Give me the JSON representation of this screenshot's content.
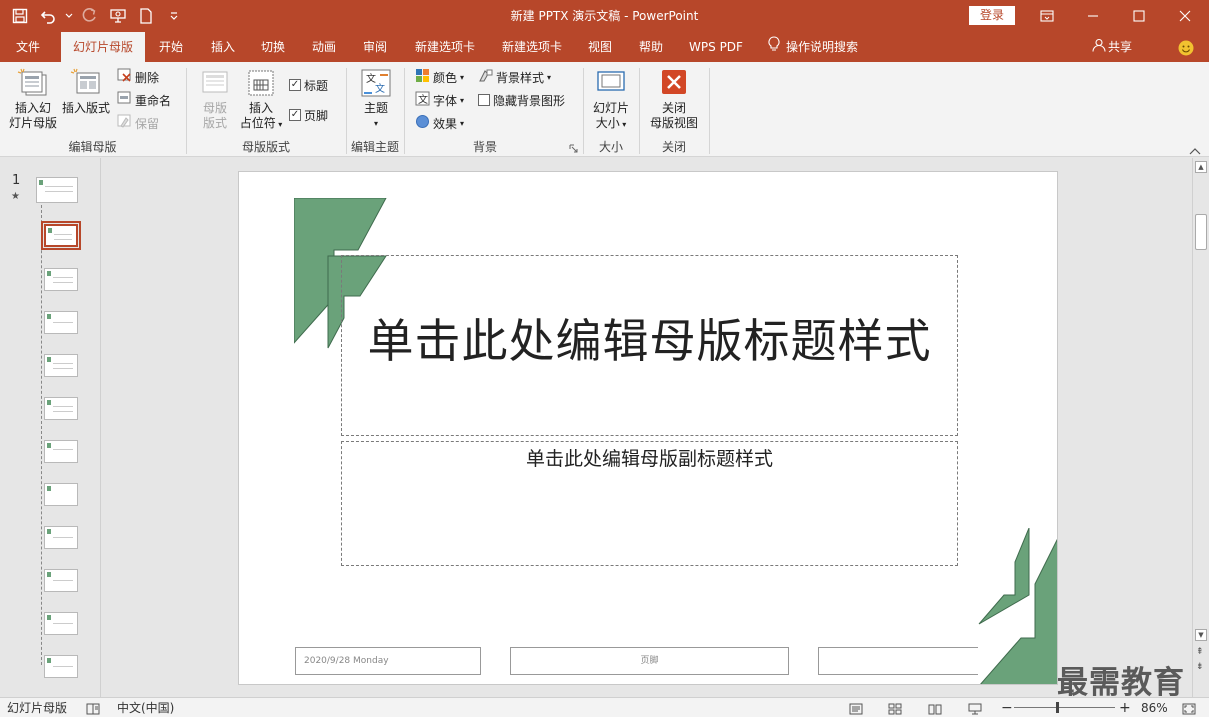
{
  "window": {
    "title": "新建 PPTX 演示文稿  -  PowerPoint",
    "login_label": "登录"
  },
  "tabs": [
    {
      "label": "文件"
    },
    {
      "label": "幻灯片母版"
    },
    {
      "label": "开始"
    },
    {
      "label": "插入"
    },
    {
      "label": "切换"
    },
    {
      "label": "动画"
    },
    {
      "label": "审阅"
    },
    {
      "label": "新建选项卡"
    },
    {
      "label": "新建选项卡"
    },
    {
      "label": "视图"
    },
    {
      "label": "帮助"
    },
    {
      "label": "WPS PDF"
    },
    {
      "label": "操作说明搜索"
    }
  ],
  "share_label": "共享",
  "ribbon": {
    "edit_master": {
      "label": "编辑母版",
      "insert_master_l1": "插入幻",
      "insert_master_l2": "灯片母版",
      "insert_layout": "插入版式",
      "delete": "删除",
      "rename": "重命名",
      "preserve": "保留"
    },
    "master_layout": {
      "label": "母版版式",
      "master_layout_l1": "母版",
      "master_layout_l2": "版式",
      "insert_placeholder_l1": "插入",
      "insert_placeholder_l2": "占位符",
      "title_check": "标题",
      "footer_check": "页脚"
    },
    "edit_theme": {
      "label": "编辑主题",
      "theme": "主题"
    },
    "background": {
      "label": "背景",
      "colors": "颜色",
      "fonts": "字体",
      "effects": "效果",
      "bg_styles": "背景样式",
      "hide_bg": "隐藏背景图形"
    },
    "size": {
      "label": "大小",
      "slide_size_l1": "幻灯片",
      "slide_size_l2": "大小"
    },
    "close": {
      "label": "关闭",
      "close_l1": "关闭",
      "close_l2": "母版视图"
    }
  },
  "thumbnails": {
    "master_number": "1",
    "master_star": "★"
  },
  "slide": {
    "title": "单击此处编辑母版标题样式",
    "subtitle": "单击此处编辑母版副标题样式",
    "footer_date": "2020/9/28 Monday",
    "footer_text": "页脚",
    "accent_color": "#6aa27a"
  },
  "statusbar": {
    "view_name": "幻灯片母版",
    "language": "中文(中国)",
    "zoom": "86%"
  },
  "watermark": "最需教育",
  "colors": {
    "brand": "#b7472a",
    "ribbon_bg": "#f3f3f3"
  }
}
